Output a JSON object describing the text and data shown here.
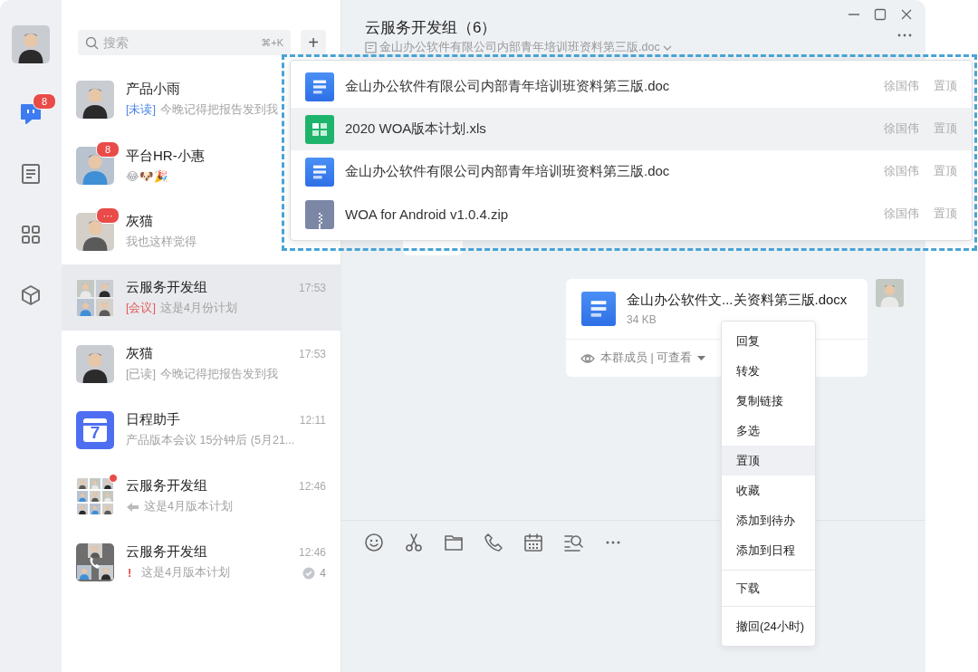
{
  "rail": [
    {
      "kind": "chat",
      "badge": "8",
      "selected": true
    },
    {
      "kind": "docs",
      "selected": false
    },
    {
      "kind": "apps",
      "selected": false
    },
    {
      "kind": "box",
      "selected": false
    }
  ],
  "search": {
    "placeholder": "搜索",
    "shortcut": "⌘+K"
  },
  "add_button": "+",
  "conversations": [
    {
      "name": "产品小雨",
      "tag": {
        "kind": "unread",
        "text": "[未读]"
      },
      "preview": "今晚记得把报告发到我",
      "selected": false
    },
    {
      "name": "平台HR-小惠",
      "badge": "8",
      "preview": "😂🐶🎉",
      "selected": false
    },
    {
      "name": "灰猫",
      "badge": "···",
      "preview": "我也这样觉得",
      "selected": false
    },
    {
      "name": "云服务开发组",
      "avatar": {
        "kind": "group4"
      },
      "tag": {
        "kind": "meeting",
        "text": "[会议]"
      },
      "preview": "这是4月份计划",
      "time": "17:53",
      "selected": true
    },
    {
      "name": "灰猫",
      "tag": {
        "kind": "read",
        "text": "[已读]"
      },
      "preview": "今晚记得把报告发到我",
      "time": "17:53",
      "selected": false
    },
    {
      "name": "日程助手",
      "avatar": {
        "kind": "calendar",
        "text": "7"
      },
      "preview": "产品版本会议 15分钟后 (5月21...",
      "time": "12:11",
      "selected": false
    },
    {
      "name": "云服务开发组",
      "avatar": {
        "kind": "group9"
      },
      "dot": true,
      "lead": {
        "kind": "voice"
      },
      "preview": "这是4月版本计划",
      "time": "12:46",
      "selected": false
    },
    {
      "name": "云服务开发组",
      "avatar": {
        "kind": "call"
      },
      "alert": "!",
      "preview": "这是4月版本计划",
      "time": "12:46",
      "read_count": "4",
      "selected": false
    }
  ],
  "chat": {
    "title": "云服务开发组（6）",
    "pinned_doc": "金山办公软件有限公司内部青年培训班资料第三版.doc"
  },
  "messages": [
    {
      "kind": "bubble"
    },
    {
      "kind": "file",
      "icon": {
        "kind": "doc"
      },
      "name": "金山办公软件文...关资料第三版.docx",
      "size": "34 KB",
      "permission": "本群成员 | 可查看"
    }
  ],
  "toolbar": [
    {
      "kind": "emoji"
    },
    {
      "kind": "scissors"
    },
    {
      "kind": "folder"
    },
    {
      "kind": "phone"
    },
    {
      "kind": "calendar"
    },
    {
      "kind": "search-list"
    },
    {
      "kind": "more"
    }
  ],
  "pinned_files": {
    "highlighted": true,
    "items": [
      {
        "name": "金山办公软件有限公司内部青年培训班资料第三版.doc",
        "icon": {
          "kind": "doc"
        },
        "owner": "徐国伟",
        "action": "置顶",
        "selected": false
      },
      {
        "name": "2020 WOA版本计划.xls",
        "icon": {
          "kind": "xls"
        },
        "owner": "徐国伟",
        "action": "置顶",
        "selected": true
      },
      {
        "name": "金山办公软件有限公司内部青年培训班资料第三版.doc",
        "icon": {
          "kind": "doc"
        },
        "owner": "徐国伟",
        "action": "置顶",
        "selected": false
      },
      {
        "name": "WOA for Android v1.0.4.zip",
        "icon": {
          "kind": "zip"
        },
        "owner": "徐国伟",
        "action": "置顶",
        "selected": false
      }
    ]
  },
  "context_menu": {
    "groups": [
      [
        {
          "label": "回复",
          "selected": false
        },
        {
          "label": "转发",
          "selected": false
        },
        {
          "label": "复制链接",
          "selected": false
        },
        {
          "label": "多选",
          "selected": false
        },
        {
          "label": "置顶",
          "selected": true
        },
        {
          "label": "收藏",
          "selected": false
        },
        {
          "label": "添加到待办",
          "selected": false
        },
        {
          "label": "添加到日程",
          "selected": false
        }
      ],
      [
        {
          "label": "下载",
          "selected": false
        }
      ],
      [
        {
          "label": "撤回(24小时)",
          "selected": false
        }
      ]
    ]
  }
}
